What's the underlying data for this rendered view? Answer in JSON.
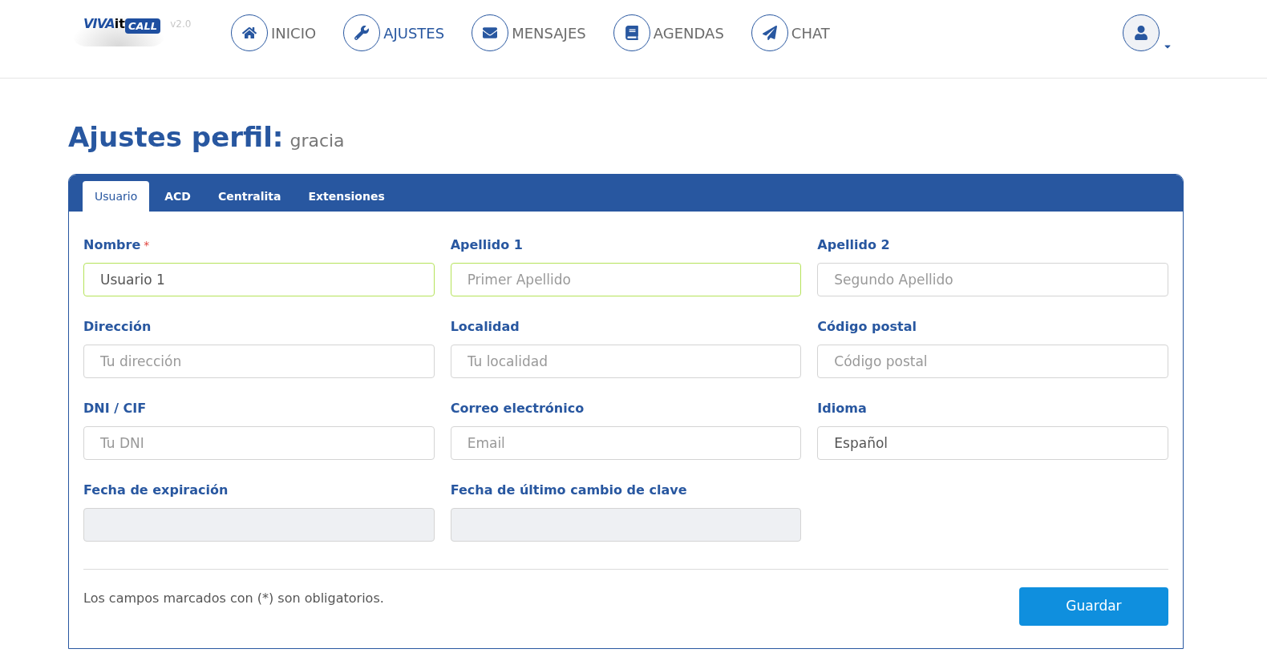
{
  "logo": {
    "part_1": "VIVA",
    "part_2": "it",
    "part_3": "CALL",
    "version": "v2.0"
  },
  "nav": [
    {
      "label": "INICIO",
      "selected": false
    },
    {
      "label": "AJUSTES",
      "selected": true
    },
    {
      "label": "MENSAJES",
      "selected": false
    },
    {
      "label": "AGENDAS",
      "selected": false
    },
    {
      "label": "CHAT",
      "selected": false
    }
  ],
  "page_title": {
    "title": "Ajustes perfil:",
    "subtitle": "gracia"
  },
  "tabs": [
    {
      "label": "Usuario",
      "selected": true
    },
    {
      "label": "ACD",
      "selected": false
    },
    {
      "label": "Centralita",
      "selected": false
    },
    {
      "label": "Extensiones",
      "selected": false
    }
  ],
  "fields": [
    {
      "label": "Nombre",
      "required": true,
      "value": "Usuario 1",
      "highlighted": true,
      "disabled": false
    },
    {
      "label": "Apellido 1",
      "required": false,
      "placeholder": "Primer Apellido",
      "highlighted": true,
      "disabled": false
    },
    {
      "label": "Apellido 2",
      "required": false,
      "placeholder": "Segundo Apellido",
      "highlighted": false,
      "disabled": false
    },
    {
      "label": "Dirección",
      "required": false,
      "placeholder": "Tu dirección",
      "highlighted": false,
      "disabled": false
    },
    {
      "label": "Localidad",
      "required": false,
      "placeholder": "Tu localidad",
      "highlighted": false,
      "disabled": false
    },
    {
      "label": "Código postal",
      "required": false,
      "placeholder": "Código postal",
      "highlighted": false,
      "disabled": false
    },
    {
      "label": "DNI / CIF",
      "required": false,
      "placeholder": "Tu DNI",
      "highlighted": false,
      "disabled": false
    },
    {
      "label": "Correo electrónico",
      "required": false,
      "placeholder": "Email",
      "highlighted": false,
      "disabled": false
    },
    {
      "label": "Idioma",
      "required": false,
      "value": "Español",
      "highlighted": false,
      "disabled": false
    },
    {
      "label": "Fecha de expiración",
      "required": false,
      "highlighted": false,
      "disabled": true
    },
    {
      "label": "Fecha de último cambio de clave",
      "required": false,
      "highlighted": false,
      "disabled": true
    }
  ],
  "required_marker": "*",
  "footer_note": "Los campos marcados con (*) son obligatorios.",
  "save_button": "Guardar"
}
